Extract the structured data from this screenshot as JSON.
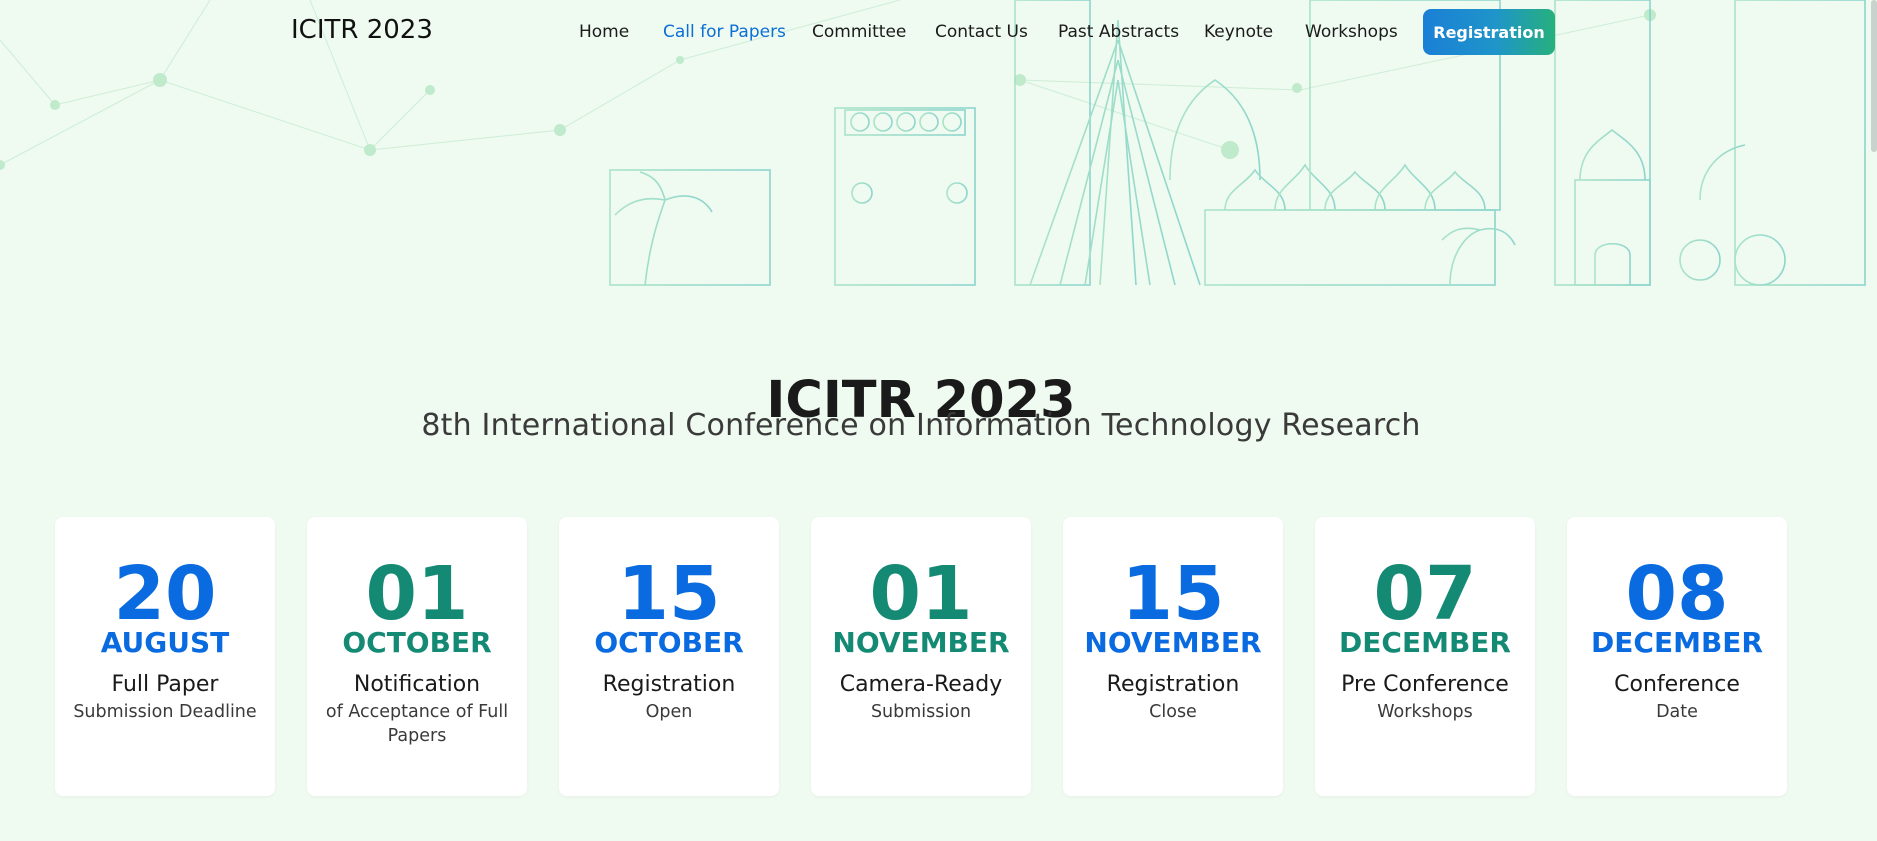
{
  "nav": {
    "brand": "ICITR 2023",
    "links": [
      "Home",
      "Call for Papers",
      "Committee",
      "Contact Us",
      "Past Abstracts",
      "Keynote",
      "Workshops"
    ],
    "active_link": "Call for Papers",
    "register_label": "Registration"
  },
  "hero": {
    "title": "ICITR 2023",
    "subtitle": "8th International Conference on Information Technology Research"
  },
  "dates": [
    {
      "day": "20",
      "month": "AUGUST",
      "event": "Full Paper",
      "detail": "Submission Deadline",
      "accent": "blue"
    },
    {
      "day": "01",
      "month": "OCTOBER",
      "event": "Notification",
      "detail": "of Acceptance of Full Papers",
      "accent": "green"
    },
    {
      "day": "15",
      "month": "OCTOBER",
      "event": "Registration",
      "detail": "Open",
      "accent": "blue"
    },
    {
      "day": "01",
      "month": "NOVEMBER",
      "event": "Camera-Ready",
      "detail": "Submission",
      "accent": "green"
    },
    {
      "day": "15",
      "month": "NOVEMBER",
      "event": "Registration",
      "detail": "Close",
      "accent": "blue"
    },
    {
      "day": "07",
      "month": "DECEMBER",
      "event": "Pre Conference",
      "detail": "Workshops",
      "accent": "green"
    },
    {
      "day": "08",
      "month": "DECEMBER",
      "event": "Conference",
      "detail": "Date",
      "accent": "blue"
    }
  ],
  "colors": {
    "page_background": "#effaf0",
    "accent_blue": "#0a6be0",
    "accent_green": "#148a75",
    "active_nav": "#0a6fd6"
  },
  "icons": [
    "city-skyline-illustration",
    "network-dots-pattern"
  ]
}
